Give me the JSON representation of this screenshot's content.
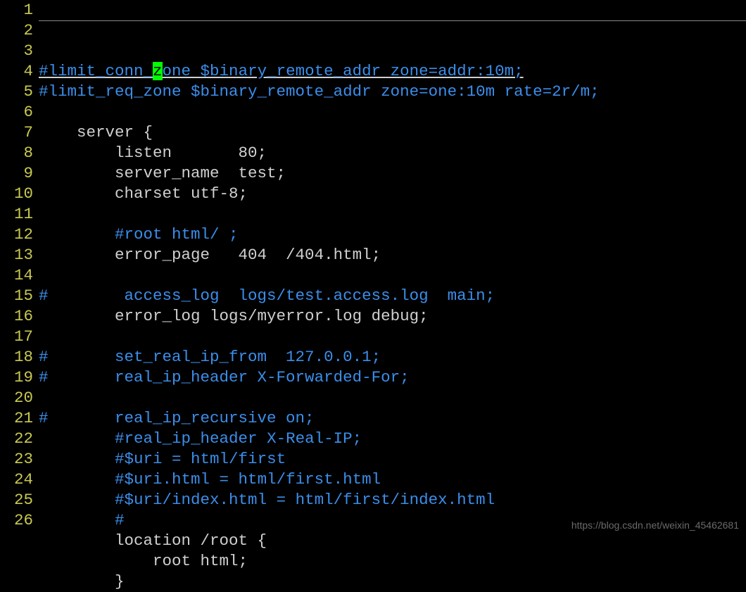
{
  "watermark": "https://blog.csdn.net/weixin_45462681",
  "lines": [
    {
      "num": "1",
      "segments": [
        {
          "cls": "comment underline-top",
          "text": "#limit_conn_"
        },
        {
          "cls": "cursor",
          "text": "z"
        },
        {
          "cls": "comment underline-top",
          "text": "one $binary_remote_addr zone=addr:10m;"
        }
      ]
    },
    {
      "num": "2",
      "segments": [
        {
          "cls": "comment",
          "text": "#limit_req_zone $binary_remote_addr zone=one:10m rate=2r/m;"
        }
      ]
    },
    {
      "num": "3",
      "segments": []
    },
    {
      "num": "4",
      "segments": [
        {
          "cls": "plain",
          "text": "    server {"
        }
      ]
    },
    {
      "num": "5",
      "segments": [
        {
          "cls": "plain",
          "text": "        listen       80;"
        }
      ]
    },
    {
      "num": "6",
      "segments": [
        {
          "cls": "plain",
          "text": "        server_name  test;"
        }
      ]
    },
    {
      "num": "7",
      "segments": [
        {
          "cls": "plain",
          "text": "        charset utf-8;"
        }
      ]
    },
    {
      "num": "8",
      "segments": []
    },
    {
      "num": "9",
      "segments": [
        {
          "cls": "plain",
          "text": "        "
        },
        {
          "cls": "comment",
          "text": "#root html/ ;"
        }
      ]
    },
    {
      "num": "10",
      "segments": [
        {
          "cls": "plain",
          "text": "        error_page   404  /404.html;"
        }
      ]
    },
    {
      "num": "11",
      "segments": []
    },
    {
      "num": "12",
      "segments": [
        {
          "cls": "comment",
          "text": "#        access_log  logs/test.access.log  main;"
        }
      ]
    },
    {
      "num": "13",
      "segments": [
        {
          "cls": "plain",
          "text": "        error_log logs/myerror.log debug;"
        }
      ]
    },
    {
      "num": "14",
      "segments": []
    },
    {
      "num": "15",
      "segments": [
        {
          "cls": "comment",
          "text": "#       set_real_ip_from  127.0.0.1;"
        }
      ]
    },
    {
      "num": "16",
      "segments": [
        {
          "cls": "comment",
          "text": "#       real_ip_header X-Forwarded-For;"
        }
      ]
    },
    {
      "num": "17",
      "segments": []
    },
    {
      "num": "18",
      "segments": [
        {
          "cls": "comment",
          "text": "#       real_ip_recursive on;"
        }
      ]
    },
    {
      "num": "19",
      "segments": [
        {
          "cls": "plain",
          "text": "        "
        },
        {
          "cls": "comment",
          "text": "#real_ip_header X-Real-IP;"
        }
      ]
    },
    {
      "num": "20",
      "segments": [
        {
          "cls": "plain",
          "text": "        "
        },
        {
          "cls": "comment",
          "text": "#$uri = html/first"
        }
      ]
    },
    {
      "num": "21",
      "segments": [
        {
          "cls": "plain",
          "text": "        "
        },
        {
          "cls": "comment",
          "text": "#$uri.html = html/first.html"
        }
      ]
    },
    {
      "num": "22",
      "segments": [
        {
          "cls": "plain",
          "text": "        "
        },
        {
          "cls": "comment",
          "text": "#$uri/index.html = html/first/index.html"
        }
      ]
    },
    {
      "num": "23",
      "segments": [
        {
          "cls": "plain",
          "text": "        "
        },
        {
          "cls": "comment",
          "text": "#"
        }
      ]
    },
    {
      "num": "24",
      "segments": [
        {
          "cls": "plain",
          "text": "        location /root {"
        }
      ]
    },
    {
      "num": "25",
      "segments": [
        {
          "cls": "plain",
          "text": "            root html;"
        }
      ]
    },
    {
      "num": "26",
      "segments": [
        {
          "cls": "plain",
          "text": "        }"
        }
      ]
    }
  ]
}
